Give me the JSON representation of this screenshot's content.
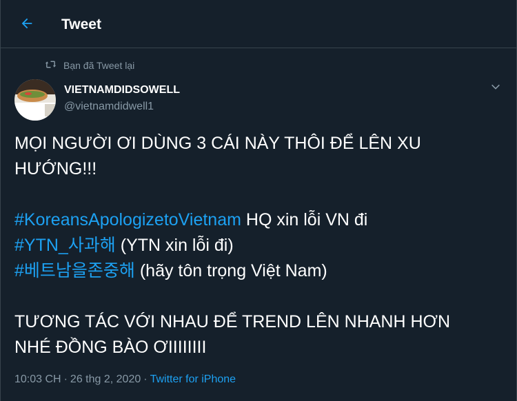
{
  "header": {
    "back_icon": "arrow-left-icon",
    "title": "Tweet"
  },
  "retweet": {
    "icon": "retweet-icon",
    "label": "Bạn đã Tweet lại"
  },
  "author": {
    "name": "VIETNAMDIDSOWELL",
    "handle": "@vietnamdidwell1",
    "avatar": "avatar-image"
  },
  "tweet": {
    "line1": "MỌI NGƯỜI ƠI DÙNG 3 CÁI NÀY THÔI ĐỂ LÊN XU",
    "line2": "HƯỚNG!!!",
    "hashtag1": "#KoreansApologizetoVietnam",
    "hashtag1_suffix": " HQ xin lỗi VN đi",
    "hashtag2": "#YTN_사과해",
    "hashtag2_suffix": " (YTN xin lỗi đi)",
    "hashtag3": "#베트남을존중해",
    "hashtag3_suffix": " (hãy tôn trọng Việt Nam)",
    "line6": "TƯƠNG TÁC VỚI NHAU ĐỂ TREND LÊN NHANH HƠN",
    "line7": "NHÉ ĐỒNG BÀO ƠIIIIIIII"
  },
  "meta": {
    "time": "10:03 CH",
    "separator1": "·",
    "date": "26 thg 2, 2020",
    "separator2": "·",
    "source": "Twitter for iPhone"
  },
  "colors": {
    "background": "#15202b",
    "accent": "#1da1f2",
    "secondary_text": "#8899a6",
    "border": "#38444d"
  }
}
